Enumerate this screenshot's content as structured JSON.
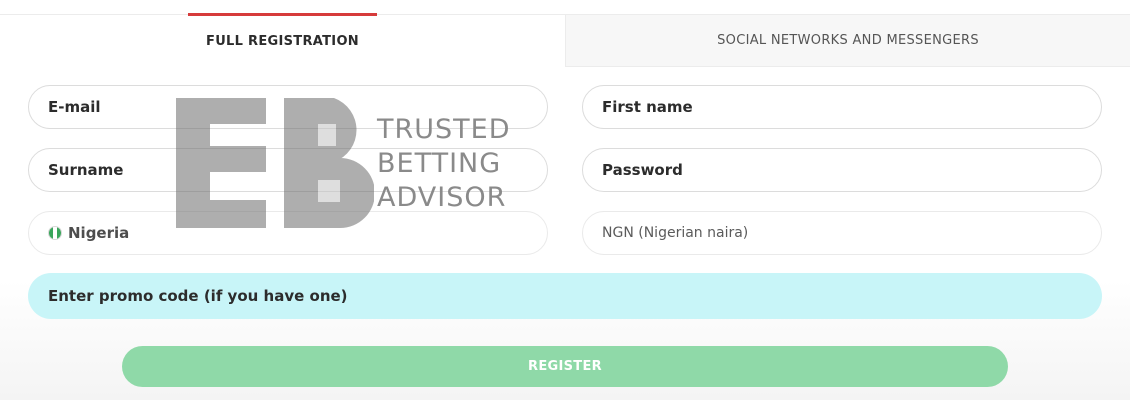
{
  "tabs": {
    "full_registration": "FULL REGISTRATION",
    "social": "SOCIAL NETWORKS AND MESSENGERS"
  },
  "form": {
    "email_placeholder": "E-mail",
    "first_name_placeholder": "First name",
    "surname_placeholder": "Surname",
    "password_placeholder": "Password",
    "country_value": "Nigeria",
    "currency_value": "NGN (Nigerian naira)",
    "promo_placeholder": "Enter promo code (if you have one)",
    "register_label": "REGISTER"
  },
  "watermark": {
    "line1": "TRUSTED",
    "line2": "BETTING",
    "line3": "ADVISOR"
  },
  "colors": {
    "tab_accent": "#d63b3b",
    "promo_bg": "#c8f5f8",
    "register_bg": "#8fd9a8",
    "flag_green": "#3aa55b"
  },
  "icons": {
    "country_flag": "nigeria-flag-icon",
    "watermark_logo": "tba-logo-icon"
  }
}
